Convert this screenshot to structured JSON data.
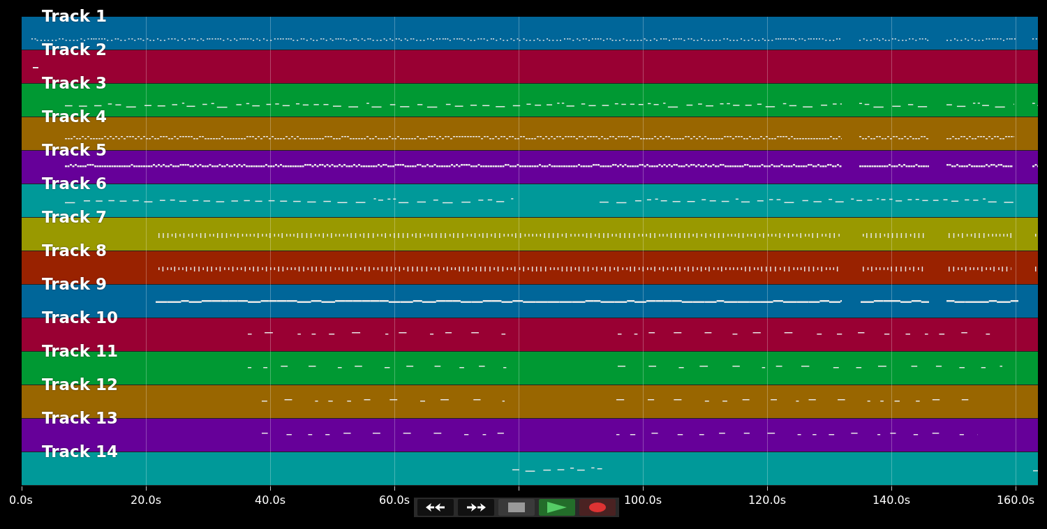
{
  "tracks": [
    {
      "name": "Track 1",
      "color": "#006699"
    },
    {
      "name": "Track 2",
      "color": "#990033"
    },
    {
      "name": "Track 3",
      "color": "#009933"
    },
    {
      "name": "Track 4",
      "color": "#996600"
    },
    {
      "name": "Track 5",
      "color": "#660099"
    },
    {
      "name": "Track 6",
      "color": "#009999"
    },
    {
      "name": "Track 7",
      "color": "#999900"
    },
    {
      "name": "Track 8",
      "color": "#992200"
    },
    {
      "name": "Track 9",
      "color": "#006699"
    },
    {
      "name": "Track 10",
      "color": "#990033"
    },
    {
      "name": "Track 11",
      "color": "#009933"
    },
    {
      "name": "Track 12",
      "color": "#996600"
    },
    {
      "name": "Track 13",
      "color": "#660099"
    },
    {
      "name": "Track 14",
      "color": "#009999"
    }
  ],
  "time_axis": {
    "labels": [
      "0.0s",
      "20.0s",
      "40.0s",
      "60.0s",
      "100.0s",
      "120.0s",
      "140.0s",
      "160.0s"
    ]
  }
}
